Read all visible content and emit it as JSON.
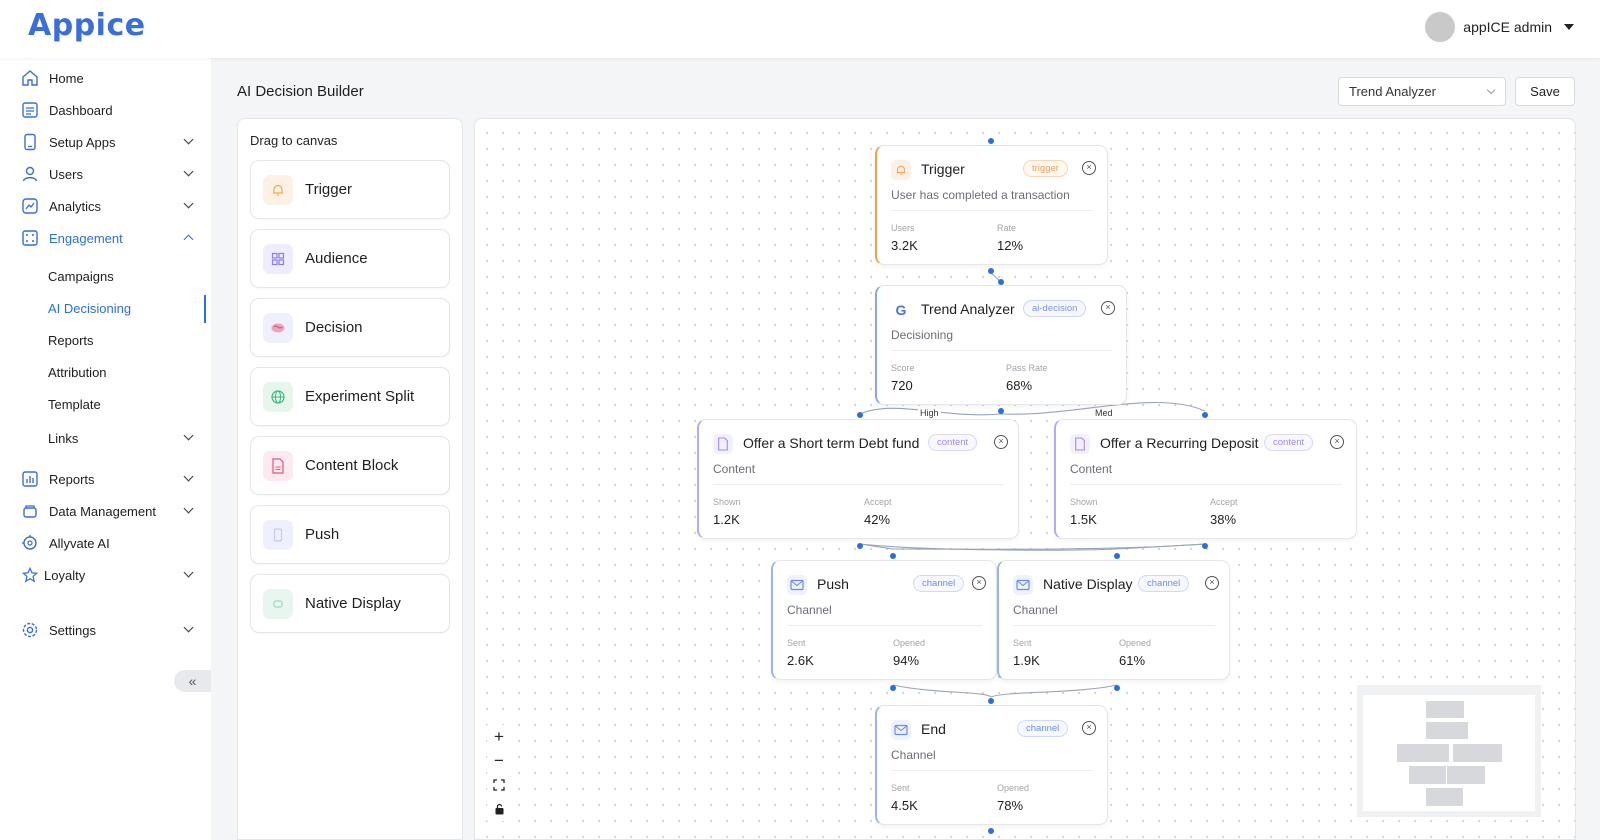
{
  "app": {
    "logo": "Appice"
  },
  "user": {
    "name": "appICE admin"
  },
  "sidebar": {
    "items": [
      {
        "label": "Home",
        "icon": "home-icon"
      },
      {
        "label": "Dashboard",
        "icon": "dashboard-icon"
      },
      {
        "label": "Setup Apps",
        "icon": "phone-icon"
      },
      {
        "label": "Users",
        "icon": "user-icon"
      },
      {
        "label": "Analytics",
        "icon": "analytics-icon"
      },
      {
        "label": "Engagement",
        "icon": "engagement-icon"
      }
    ],
    "engagement_sub": [
      "Campaigns",
      "AI Decisioning",
      "Reports",
      "Attribution",
      "Template",
      "Links"
    ],
    "lower_items": [
      {
        "label": "Reports",
        "icon": "reports-icon"
      },
      {
        "label": "Data Management",
        "icon": "database-icon"
      },
      {
        "label": "Allyvate AI",
        "icon": "ai-icon"
      },
      {
        "label": "Loyalty",
        "icon": "star-icon"
      },
      {
        "label": "Settings",
        "icon": "gear-icon"
      }
    ],
    "collapse_label": "«"
  },
  "page": {
    "title": "AI Decision Builder"
  },
  "toolbar": {
    "selected_flow": "Trend Analyzer",
    "save_label": "Save"
  },
  "palette": {
    "title": "Drag to canvas",
    "items": [
      {
        "label": "Trigger",
        "icon": "bell-icon",
        "color": "#f2a65a"
      },
      {
        "label": "Audience",
        "icon": "grid-icon",
        "color": "#8a7cf0"
      },
      {
        "label": "Decision",
        "icon": "brain-icon",
        "color": "#e06b8b"
      },
      {
        "label": "Experiment Split",
        "icon": "globe-icon",
        "color": "#3bb57a"
      },
      {
        "label": "Content Block",
        "icon": "document-icon",
        "color": "#e0568a"
      },
      {
        "label": "Push",
        "icon": "phone-icon",
        "color": "#7e8fe8"
      },
      {
        "label": "Native Display",
        "icon": "display-icon",
        "color": "#4cc08f"
      }
    ]
  },
  "nodes": {
    "trigger": {
      "title": "Trigger",
      "badge": "trigger",
      "sub": "User has completed a transaction",
      "m1_label": "Users",
      "m1_value": "3.2K",
      "m2_label": "Rate",
      "m2_value": "12%"
    },
    "decision": {
      "title": "Trend Analyzer",
      "badge": "ai-decision",
      "sub": "Decisioning",
      "m1_label": "Score",
      "m1_value": "720",
      "m2_label": "Pass Rate",
      "m2_value": "68%"
    },
    "content_a": {
      "title": "Offer a Short term Debt fund",
      "badge": "content",
      "sub": "Content",
      "m1_label": "Shown",
      "m1_value": "1.2K",
      "m2_label": "Accept",
      "m2_value": "42%"
    },
    "content_b": {
      "title": "Offer a Recurring Deposit",
      "badge": "content",
      "sub": "Content",
      "m1_label": "Shown",
      "m1_value": "1.5K",
      "m2_label": "Accept",
      "m2_value": "38%"
    },
    "push": {
      "title": "Push",
      "badge": "channel",
      "sub": "Channel",
      "m1_label": "Sent",
      "m1_value": "2.6K",
      "m2_label": "Opened",
      "m2_value": "94%"
    },
    "native": {
      "title": "Native Display",
      "badge": "channel",
      "sub": "Channel",
      "m1_label": "Sent",
      "m1_value": "1.9K",
      "m2_label": "Opened",
      "m2_value": "61%"
    },
    "end": {
      "title": "End",
      "badge": "channel",
      "sub": "Channel",
      "m1_label": "Sent",
      "m1_value": "4.5K",
      "m2_label": "Opened",
      "m2_value": "78%"
    }
  },
  "edge_labels": {
    "high": "High",
    "med": "Med"
  },
  "controls": {
    "zoom_in": "+",
    "zoom_out": "−"
  },
  "colors": {
    "accent": "#2d6fd6",
    "trigger": "#f0a14c",
    "node_border": "#e4e6ea"
  }
}
